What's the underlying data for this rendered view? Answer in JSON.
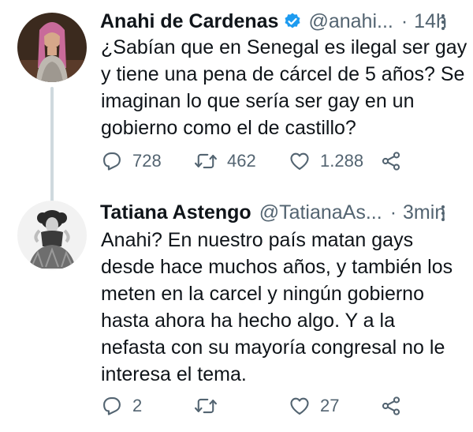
{
  "tweets": [
    {
      "name": "Anahi de Cardenas",
      "verified": true,
      "handle": "@anahi...",
      "dot": "·",
      "time": "14h",
      "text_lines": [
        "¿Sabían que en Senegal es ilegal ser gay",
        "y tiene una pena de cárcel de 5 años? Se",
        "imaginan lo que sería ser gay en un",
        "gobierno como el de castillo?"
      ],
      "replies": "728",
      "retweets": "462",
      "likes": "1.288"
    },
    {
      "name": "Tatiana Astengo",
      "verified": false,
      "handle": "@TatianaAs...",
      "dot": "·",
      "time": "3min",
      "text_lines": [
        "Anahi? En nuestro país matan gays",
        "desde hace muchos años, y también los",
        "meten en la carcel y ningún gobierno",
        "hasta ahora ha hecho algo. Y a la",
        "nefasta con su mayoría congresal no le",
        "interesa el tema."
      ],
      "replies": "2",
      "retweets": "",
      "likes": "27"
    }
  ],
  "colors": {
    "text": "#0f1419",
    "secondary": "#536471",
    "verified": "#1d9bf0",
    "thread_line": "#cfd9de"
  },
  "icons": [
    "reply-icon",
    "retweet-icon",
    "like-icon",
    "share-icon",
    "more-icon",
    "verified-badge-icon"
  ]
}
